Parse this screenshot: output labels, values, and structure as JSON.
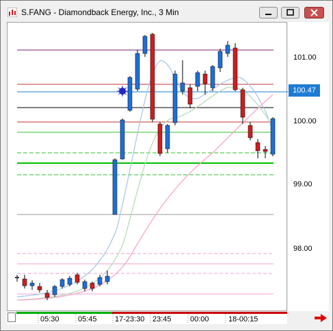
{
  "window": {
    "title": "S.FANG - Diamondback Energy, Inc., 3 Min"
  },
  "y_axis": {
    "labels": [
      "101.00",
      "100.47",
      "100.00",
      "99.00",
      "98.00"
    ],
    "current_price": "100.47"
  },
  "x_axis": {
    "labels": [
      "05:30",
      "05:45",
      "17-23:30",
      "23:45",
      "00:00",
      "18-00:15"
    ]
  },
  "colors": {
    "up_candle": "#1e6fd9",
    "down_candle": "#cc1f1f",
    "price_line": "#1e7cd4",
    "session_green": "#00c000",
    "session_red": "#cc0000"
  },
  "icons": {
    "app": "chart-app-icon",
    "scroll": "red-right-arrow-icon",
    "marker": "starburst-marker-icon"
  }
}
